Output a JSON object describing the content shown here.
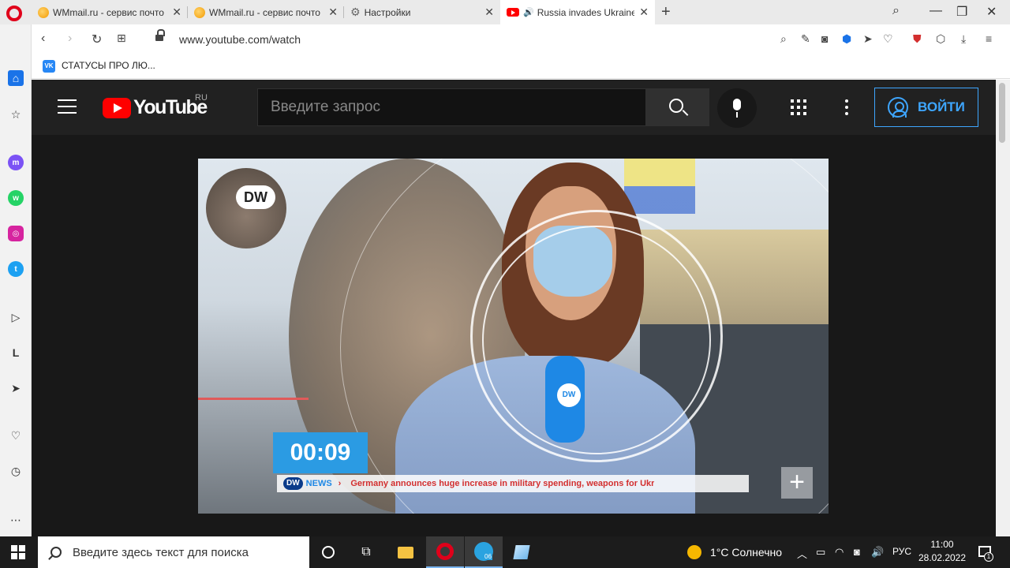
{
  "browser": {
    "tabs": [
      {
        "title": "WMmail.ru - сервис почто",
        "icon": "wmmail-favicon"
      },
      {
        "title": "WMmail.ru - сервис почто",
        "icon": "wmmail-favicon"
      },
      {
        "title": "Настройки",
        "icon": "gear-icon"
      },
      {
        "title": "Russia invades Ukraine",
        "icon": "youtube-favicon",
        "active": true
      }
    ],
    "url": "www.youtube.com/watch",
    "bookmark": "СТАТУСЫ ПРО ЛЮ...",
    "bookmark_icon_text": "VK"
  },
  "youtube": {
    "logo_text": "YouTube",
    "region": "RU",
    "search_placeholder": "Введите запрос",
    "sign_in": "ВОЙТИ",
    "accent_color": "#3ea6ff",
    "brand_color": "#ff0000"
  },
  "video": {
    "timer": "00:09",
    "channel_logo": "DW",
    "ticker_channel": "DW",
    "ticker_label": "NEWS",
    "ticker_headline": "Germany announces huge increase in military spending, weapons for Ukr",
    "ticker_prefix": "›",
    "plus_label": "+"
  },
  "taskbar": {
    "search_placeholder": "Введите здесь текст для поиска",
    "weather": "1°C  Солнечно",
    "language": "РУС",
    "time": "11:00",
    "date": "28.02.2022",
    "telegram_badge": "06",
    "notification_count": "1"
  }
}
